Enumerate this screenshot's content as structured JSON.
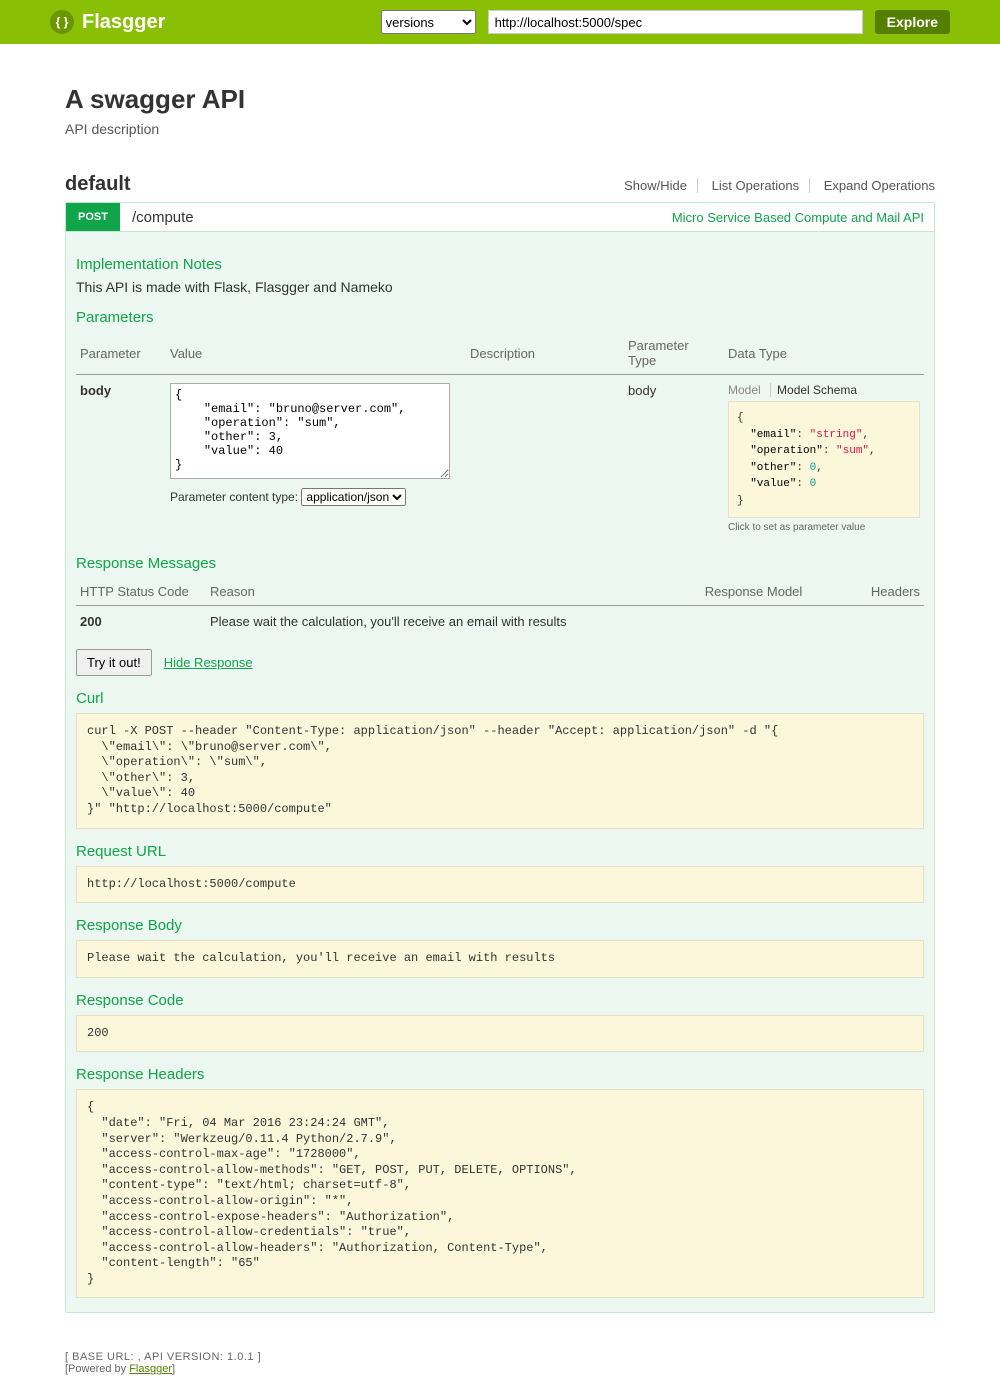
{
  "topbar": {
    "brand": "Flasgger",
    "versions_label": "versions",
    "spec_url": "http://localhost:5000/spec",
    "explore": "Explore"
  },
  "api": {
    "title": "A swagger API",
    "description": "API description"
  },
  "tag": {
    "name": "default",
    "show_hide": "Show/Hide",
    "list_ops": "List Operations",
    "expand_ops": "Expand Operations"
  },
  "op": {
    "method": "POST",
    "path": "/compute",
    "summary": "Micro Service Based Compute and Mail API",
    "impl_notes_title": "Implementation Notes",
    "impl_notes": "This API is made with Flask, Flasgger and Nameko",
    "params_title": "Parameters",
    "param_headers": {
      "parameter": "Parameter",
      "value": "Value",
      "description": "Description",
      "ptype": "Parameter Type",
      "dtype": "Data Type"
    },
    "param": {
      "name": "body",
      "value": "{\n    \"email\": \"bruno@server.com\",\n    \"operation\": \"sum\",\n    \"other\": 3,\n    \"value\": 40\n}",
      "content_type_label": "Parameter content type:",
      "content_type": "application/json",
      "ptype": "body",
      "schema_tab_model": "Model",
      "schema_tab_schema": "Model Schema",
      "schema_hint": "Click to set as parameter value"
    },
    "resp_msgs_title": "Response Messages",
    "resp_headers": {
      "code": "HTTP Status Code",
      "reason": "Reason",
      "model": "Response Model",
      "headers": "Headers"
    },
    "resp_row": {
      "code": "200",
      "reason": "Please wait the calculation, you'll receive an email with results"
    },
    "try_label": "Try it out!",
    "hide_resp": "Hide Response",
    "curl_title": "Curl",
    "curl": "curl -X POST --header \"Content-Type: application/json\" --header \"Accept: application/json\" -d \"{\n  \\\"email\\\": \\\"bruno@server.com\\\",\n  \\\"operation\\\": \\\"sum\\\",\n  \\\"other\\\": 3,\n  \\\"value\\\": 40\n}\" \"http://localhost:5000/compute\"",
    "req_url_title": "Request URL",
    "req_url": "http://localhost:5000/compute",
    "resp_body_title": "Response Body",
    "resp_body": "Please wait the calculation, you'll receive an email with results",
    "resp_code_title": "Response Code",
    "resp_code": "200",
    "resp_headers_title": "Response Headers",
    "resp_headers_body": "{\n  \"date\": \"Fri, 04 Mar 2016 23:24:24 GMT\",\n  \"server\": \"Werkzeug/0.11.4 Python/2.7.9\",\n  \"access-control-max-age\": \"1728000\",\n  \"access-control-allow-methods\": \"GET, POST, PUT, DELETE, OPTIONS\",\n  \"content-type\": \"text/html; charset=utf-8\",\n  \"access-control-allow-origin\": \"*\",\n  \"access-control-expose-headers\": \"Authorization\",\n  \"access-control-allow-credentials\": \"true\",\n  \"access-control-allow-headers\": \"Authorization, Content-Type\",\n  \"content-length\": \"65\"\n}"
  },
  "footer": {
    "base": "[ BASE URL: , API VERSION: 1.0.1 ]",
    "powered_prefix": "[Powered by ",
    "powered_link": "Flasgger",
    "powered_suffix": "]"
  }
}
